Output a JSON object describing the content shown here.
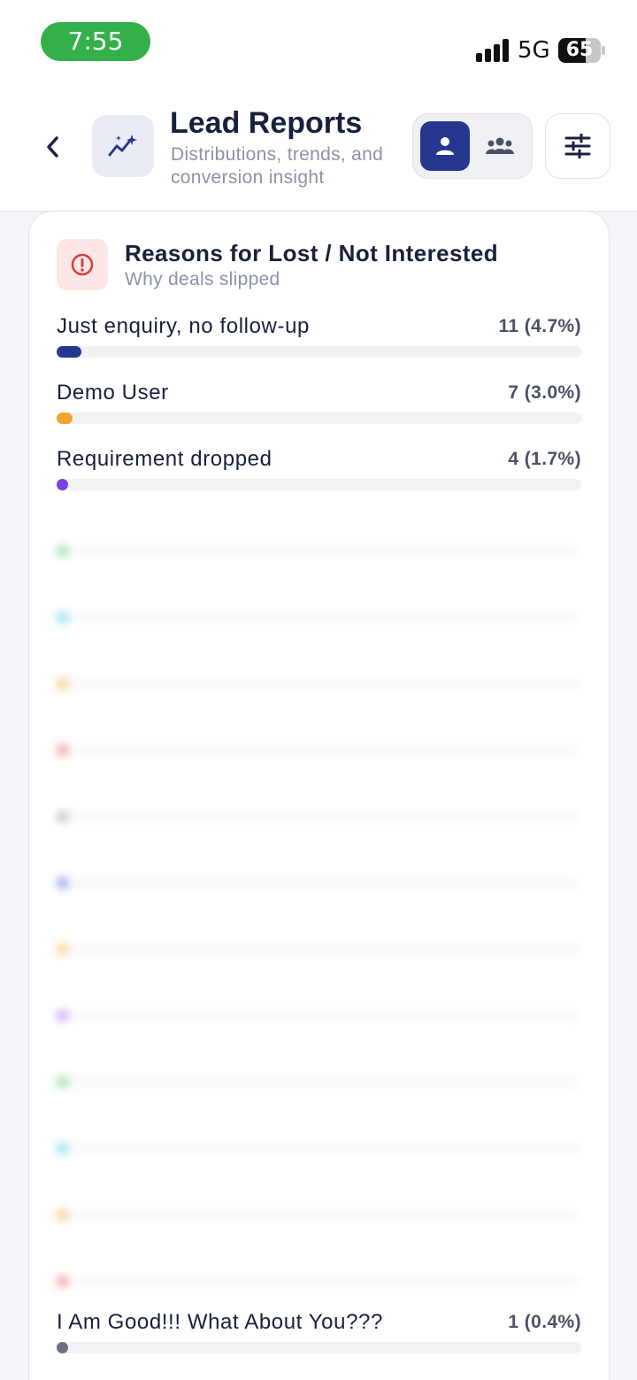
{
  "status_bar": {
    "time": "7:55",
    "network": "5G",
    "battery": "65",
    "battery_level": 0.65
  },
  "header": {
    "title": "Lead Reports",
    "subtitle": "Distributions, trends, and conversion insight",
    "back_icon": "chevron-left-icon",
    "title_icon": "sparkle-trend-icon",
    "view_toggle": [
      {
        "icon": "user-icon",
        "active": true
      },
      {
        "icon": "team-icon",
        "active": false
      }
    ],
    "filter_icon": "sliders-icon"
  },
  "card": {
    "title": "Reasons for Lost / Not Interested",
    "subtitle": "Why deals slipped",
    "icon": "alert-circle-icon",
    "reasons": [
      {
        "label": "Just enquiry, no follow-up",
        "count": "11 (4.7%)",
        "fraction": 0.047,
        "color": "#26378f",
        "obscured": false
      },
      {
        "label": "Demo User",
        "count": "7 (3.0%)",
        "fraction": 0.03,
        "color": "#f0a631",
        "obscured": false
      },
      {
        "label": "Requirement dropped",
        "count": "4 (1.7%)",
        "fraction": 0.017,
        "color": "#7b3fe4",
        "obscured": false
      },
      {
        "label": "",
        "count": "",
        "fraction": 0.013,
        "color": "#4cc46a",
        "obscured": true
      },
      {
        "label": "",
        "count": "",
        "fraction": 0.013,
        "color": "#3fc6e6",
        "obscured": true
      },
      {
        "label": "",
        "count": "",
        "fraction": 0.004,
        "color": "#f0a631",
        "obscured": true
      },
      {
        "label": "",
        "count": "",
        "fraction": 0.004,
        "color": "#ef4d4d",
        "obscured": true
      },
      {
        "label": "",
        "count": "",
        "fraction": 0.004,
        "color": "#8a8f99",
        "obscured": true
      },
      {
        "label": "",
        "count": "",
        "fraction": 0.004,
        "color": "#3f55e0",
        "obscured": true
      },
      {
        "label": "",
        "count": "",
        "fraction": 0.004,
        "color": "#f4b23c",
        "obscured": true
      },
      {
        "label": "",
        "count": "",
        "fraction": 0.004,
        "color": "#9b5cf0",
        "obscured": true
      },
      {
        "label": "",
        "count": "",
        "fraction": 0.004,
        "color": "#4cc46a",
        "obscured": true
      },
      {
        "label": "",
        "count": "",
        "fraction": 0.004,
        "color": "#3fc6e6",
        "obscured": true
      },
      {
        "label": "",
        "count": "",
        "fraction": 0.004,
        "color": "#f0a631",
        "obscured": true
      },
      {
        "label": "",
        "count": "",
        "fraction": 0.004,
        "color": "#ef4d4d",
        "obscured": true
      },
      {
        "label": "I Am Good!!! What About You???",
        "count": "1 (0.4%)",
        "fraction": 0.004,
        "color": "#6b7080",
        "obscured": false
      }
    ]
  }
}
